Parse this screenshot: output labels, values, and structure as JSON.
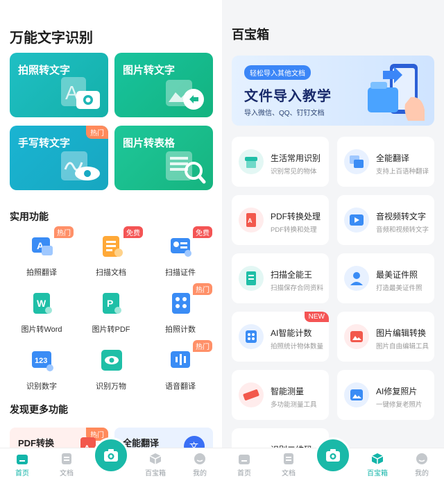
{
  "left": {
    "title": "万能文字识别",
    "tiles": [
      {
        "label": "拍照转文字",
        "badge": ""
      },
      {
        "label": "图片转文字",
        "badge": ""
      },
      {
        "label": "手写转文字",
        "badge": "热门"
      },
      {
        "label": "图片转表格",
        "badge": ""
      }
    ],
    "practical_title": "实用功能",
    "practical": [
      {
        "label": "拍照翻译",
        "badge": "热门"
      },
      {
        "label": "扫描文档",
        "badge": "免费"
      },
      {
        "label": "扫描证件",
        "badge": "免费"
      },
      {
        "label": "图片转Word",
        "badge": ""
      },
      {
        "label": "图片转PDF",
        "badge": ""
      },
      {
        "label": "拍照计数",
        "badge": "热门"
      },
      {
        "label": "识别数字",
        "badge": ""
      },
      {
        "label": "识别万物",
        "badge": ""
      },
      {
        "label": "语音翻译",
        "badge": "热门"
      }
    ],
    "discover_title": "发现更多功能",
    "discover": [
      {
        "label": "PDF转换",
        "badge": "热门"
      },
      {
        "label": "全能翻译",
        "badge": ""
      }
    ]
  },
  "right": {
    "title": "百宝箱",
    "banner": {
      "pill": "轻松导入其他文档",
      "title": "文件导入教学",
      "subtitle": "导入微信、QQ、钉钉文档"
    },
    "cards": [
      {
        "title": "生活常用识别",
        "sub": "识别常见的物体",
        "badge": ""
      },
      {
        "title": "全能翻译",
        "sub": "支持上百语种翻译",
        "badge": ""
      },
      {
        "title": "PDF转换处理",
        "sub": "PDF转换和处理",
        "badge": ""
      },
      {
        "title": "音视频转文字",
        "sub": "音频和视频转文字",
        "badge": ""
      },
      {
        "title": "扫描全能王",
        "sub": "扫描保存合同资料",
        "badge": ""
      },
      {
        "title": "最美证件照",
        "sub": "打造最美证件照",
        "badge": ""
      },
      {
        "title": "AI智能计数",
        "sub": "拍照统计物体数量",
        "badge": "NEW"
      },
      {
        "title": "图片编辑转换",
        "sub": "图片自由编辑工具",
        "badge": ""
      },
      {
        "title": "智能测量",
        "sub": "多功能测量工具",
        "badge": ""
      },
      {
        "title": "AI修复照片",
        "sub": "一键修复老照片",
        "badge": ""
      },
      {
        "title": "识别二维码",
        "sub": "",
        "badge": ""
      }
    ]
  },
  "nav": {
    "home": "首页",
    "docs": "文档",
    "toolbox": "百宝箱",
    "mine": "我的"
  },
  "colors": {
    "accent": "#13b5a9",
    "hot": "#ff9068",
    "free": "#f45454"
  }
}
